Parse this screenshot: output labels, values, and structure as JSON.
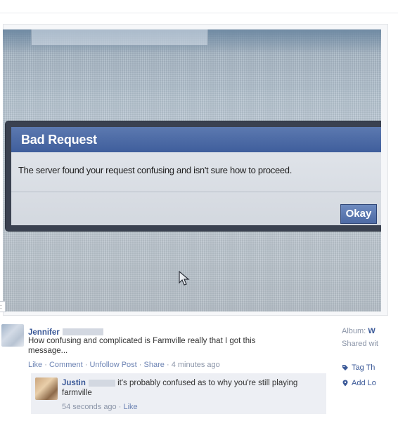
{
  "photo": {
    "dialog": {
      "title": "Bad Request",
      "message": "The server found your request confusing and isn't sure how to proceed.",
      "button": "Okay"
    }
  },
  "edge_tab": ":",
  "post": {
    "author": "Jennifer",
    "text": "How confusing and complicated is Farmville really that I got this message...",
    "actions": {
      "like": "Like",
      "comment": "Comment",
      "unfollow": "Unfollow Post",
      "share": "Share",
      "time": "4 minutes ago"
    },
    "comment": {
      "author": "Justin",
      "text": "it's probably confused as to why you're still playing farmville",
      "time": "54 seconds ago",
      "like": "Like"
    }
  },
  "sidebar": {
    "album_label": "Album:",
    "album_value": "W",
    "shared_with": "Shared wit",
    "tag": "Tag Th",
    "location": "Add Lo"
  },
  "colors": {
    "facebook_blue": "#3b5998",
    "link": "#6d84b4",
    "meta_gray": "#8b95a8",
    "dialog_title": "#4a67a1"
  },
  "icons": {
    "cursor": "mouse-pointer-icon",
    "tag": "tag-icon",
    "location": "location-pin-icon"
  }
}
